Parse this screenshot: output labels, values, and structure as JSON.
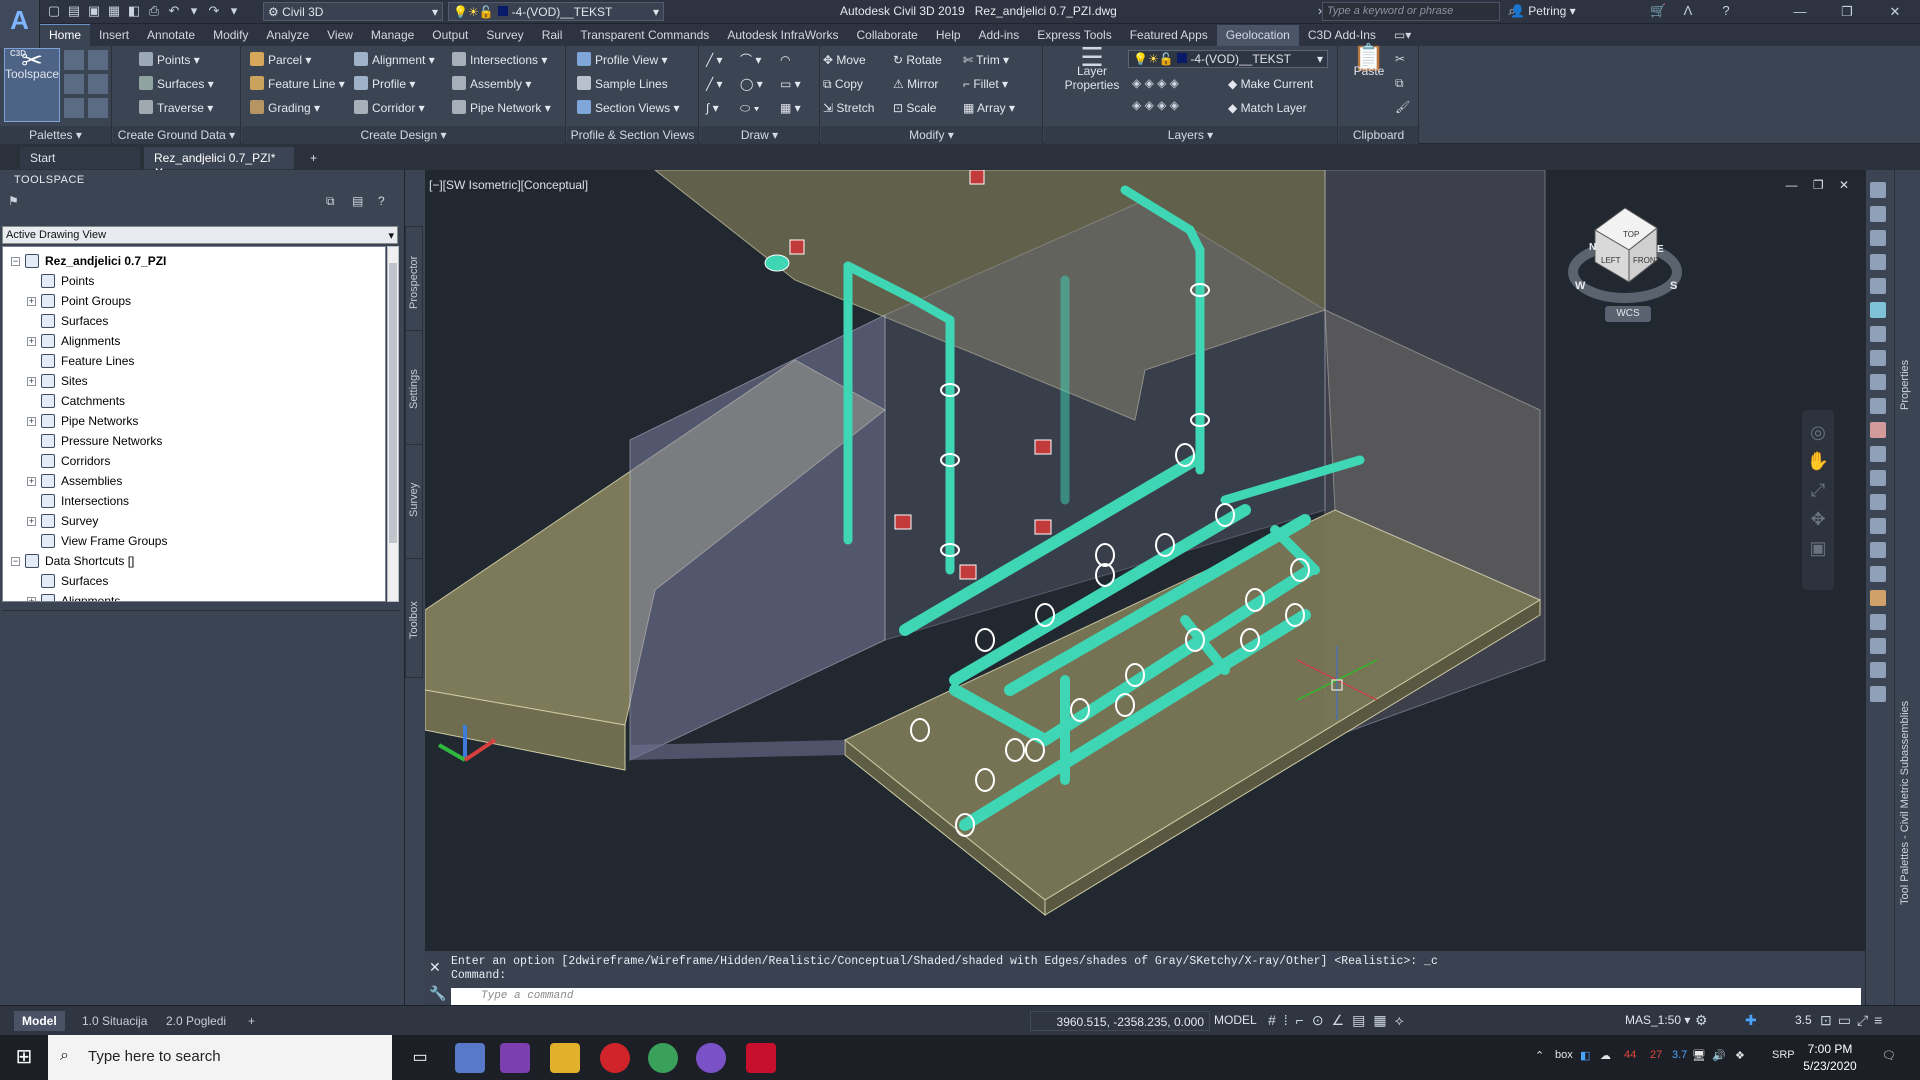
{
  "app": {
    "logo": "A",
    "logo_sub": "C3D",
    "title": "Autodesk Civil 3D 2019",
    "filename": "Rez_andjelici 0.7_PZI.dwg"
  },
  "quickaccess": {
    "workspace": "Civil 3D",
    "layer": "-4-(VOD)__TEKST",
    "search_placeholder": "Type a keyword or phrase",
    "user": "Petring"
  },
  "ribbon_tabs": [
    "Home",
    "Insert",
    "Annotate",
    "Modify",
    "Analyze",
    "View",
    "Manage",
    "Output",
    "Survey",
    "Rail",
    "Transparent Commands",
    "Autodesk InfraWorks",
    "Help",
    "Add-ins",
    "Collaborate",
    "Express Tools",
    "Featured Apps",
    "Geolocation",
    "C3D Add-Ins"
  ],
  "panels": {
    "palettes": {
      "title": "Palettes",
      "toolspace": "Toolspace"
    },
    "ground": {
      "title": "Create Ground Data",
      "items": [
        "Points",
        "Surfaces",
        "Traverse"
      ]
    },
    "design": {
      "title": "Create Design",
      "items": [
        "Parcel",
        "Feature Line",
        "Grading",
        "Alignment",
        "Profile",
        "Corridor",
        "Intersections",
        "Assembly",
        "Pipe Network"
      ]
    },
    "profile": {
      "title": "Profile & Section Views",
      "items": [
        "Profile View",
        "Sample Lines",
        "Section Views"
      ]
    },
    "draw": {
      "title": "Draw"
    },
    "modify": {
      "title": "Modify",
      "items": [
        "Move",
        "Copy",
        "Stretch",
        "Rotate",
        "Mirror",
        "Scale",
        "Trim",
        "Fillet",
        "Array"
      ]
    },
    "layers": {
      "title": "Layers",
      "big": "Layer Properties",
      "layer_value": "-4-(VOD)__TEKST",
      "items": [
        "Make Current",
        "Match Layer"
      ]
    },
    "clipboard": {
      "title": "Clipboard",
      "big": "Paste"
    }
  },
  "doc_tabs": [
    "Start",
    "Rez_andjelici 0.7_PZI*"
  ],
  "toolspace": {
    "header": "TOOLSPACE",
    "view": "Active Drawing View",
    "tree": [
      {
        "label": "Rez_andjelici 0.7_PZI",
        "level": 0,
        "exp": "−",
        "bold": true
      },
      {
        "label": "Points",
        "level": 1,
        "exp": ""
      },
      {
        "label": "Point Groups",
        "level": 1,
        "exp": "+"
      },
      {
        "label": "Surfaces",
        "level": 1,
        "exp": ""
      },
      {
        "label": "Alignments",
        "level": 1,
        "exp": "+"
      },
      {
        "label": "Feature Lines",
        "level": 1,
        "exp": ""
      },
      {
        "label": "Sites",
        "level": 1,
        "exp": "+"
      },
      {
        "label": "Catchments",
        "level": 1,
        "exp": ""
      },
      {
        "label": "Pipe Networks",
        "level": 1,
        "exp": "+"
      },
      {
        "label": "Pressure Networks",
        "level": 1,
        "exp": ""
      },
      {
        "label": "Corridors",
        "level": 1,
        "exp": ""
      },
      {
        "label": "Assemblies",
        "level": 1,
        "exp": "+"
      },
      {
        "label": "Intersections",
        "level": 1,
        "exp": ""
      },
      {
        "label": "Survey",
        "level": 1,
        "exp": "+"
      },
      {
        "label": "View Frame Groups",
        "level": 1,
        "exp": ""
      },
      {
        "label": "Data Shortcuts []",
        "level": 0,
        "exp": "−"
      },
      {
        "label": "Surfaces",
        "level": 1,
        "exp": ""
      },
      {
        "label": "Alignments",
        "level": 1,
        "exp": "+"
      }
    ],
    "side_tabs": [
      "Prospector",
      "Settings",
      "Survey",
      "Toolbox"
    ]
  },
  "viewport": {
    "label": "[−][SW Isometric][Conceptual]",
    "wcs": "WCS",
    "cube": {
      "top": "TOP",
      "left": "LEFT",
      "front": "FRONT"
    },
    "compass": [
      "W",
      "S",
      "N",
      "E"
    ]
  },
  "right_palette": {
    "labels": [
      "Properties",
      "Tool Palettes - Civil Metric Subassemblies"
    ]
  },
  "command": {
    "history": [
      "Enter an option [2dwireframe/Wireframe/Hidden/Realistic/Conceptual/Shaded/shaded with Edges/shades of Gray/SKetchy/X-ray/Other] <Realistic>: _c",
      "Command:"
    ],
    "placeholder": "Type a command"
  },
  "status": {
    "layouts": [
      "Model",
      "1.0 Situacija",
      "2.0 Pogledi"
    ],
    "coords": "3960.515, -2358.235, 0.000",
    "mode": "MODEL",
    "scale": "MAS_1:50",
    "lineweight": "3.5"
  },
  "taskbar": {
    "search": "Type here to search",
    "time": "7:00 PM",
    "date": "5/23/2020",
    "lang": "SRP",
    "tray": [
      "box",
      "44",
      "27",
      "3.7"
    ]
  },
  "colors": {
    "accent": "#6a90c8",
    "pipe": "#3ed6b4",
    "flange": "#ffffff",
    "valve": "#c23a3a",
    "wall": "#8b8a68",
    "background": "#212830"
  }
}
